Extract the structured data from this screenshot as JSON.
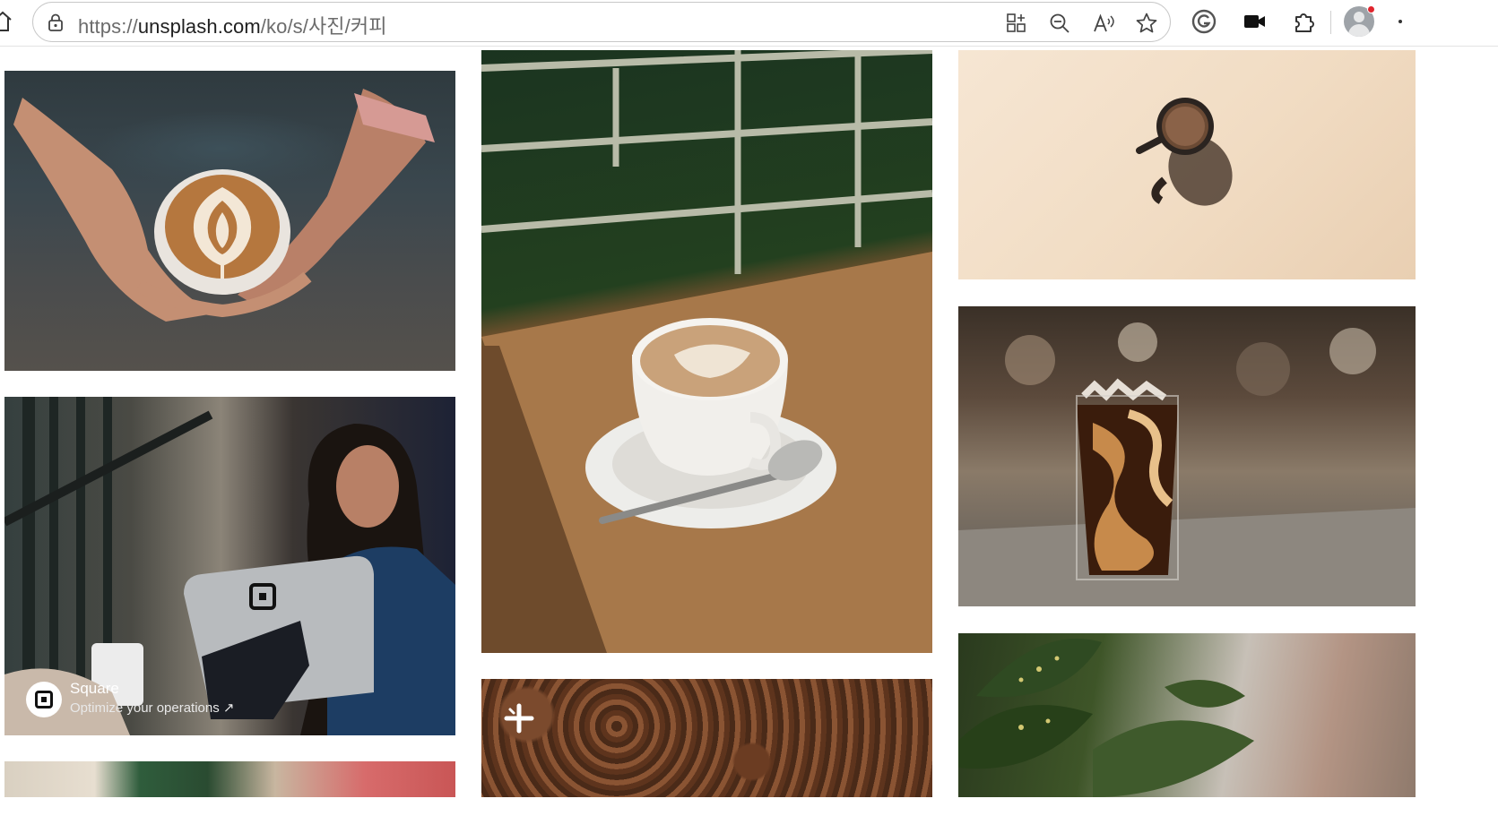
{
  "browser": {
    "url_prefix": "https://",
    "url_host": "unsplash.com",
    "url_path": "/ko/s/사진/커피"
  },
  "icons": {
    "home": "home-icon",
    "lock": "lock-icon",
    "app_available": "app-available-icon",
    "zoom": "zoom-out-icon",
    "read_aloud": "read-aloud-icon",
    "favorite": "favorite-star-icon",
    "grammarly": "grammarly-icon",
    "video": "video-capture-icon",
    "extensions": "extensions-puzzle-icon",
    "profile": "profile-avatar-icon",
    "more": "more-icon",
    "sponsor_logo": "square-logo-icon",
    "plus": "plus-badge-icon"
  },
  "colors": {
    "notification_dot": "#e0242d"
  },
  "photos": [
    {
      "alt": "latte art cup held in two hands"
    },
    {
      "alt": "woman smiling behind Square point of sale"
    },
    {
      "alt": "partially visible photo"
    },
    {
      "alt": "latte on saucer with spoon on wooden counter"
    },
    {
      "alt": "coffee beans"
    },
    {
      "alt": "espresso cup on beige background"
    },
    {
      "alt": "iced coffee with cream"
    },
    {
      "alt": "plant leaves"
    }
  ],
  "sponsored": {
    "name": "Square",
    "tagline": "Optimize your operations",
    "arrow": "↗"
  }
}
